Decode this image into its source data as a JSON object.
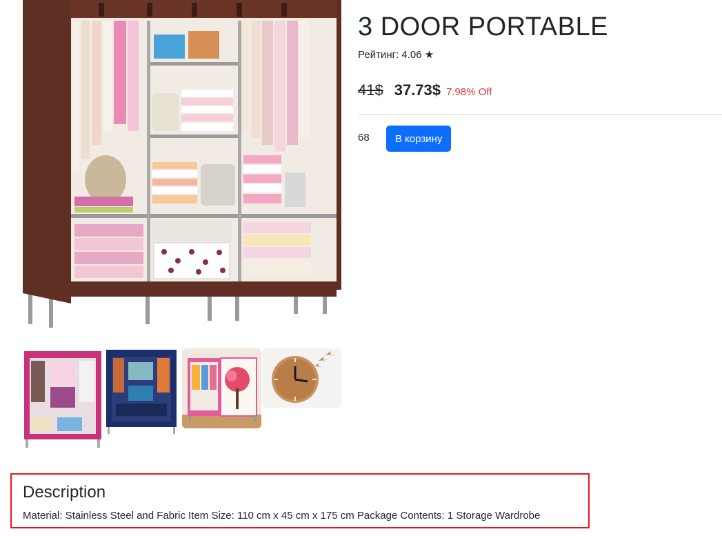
{
  "product": {
    "title": "3 DOOR PORTABLE",
    "rating_label": "Рейтинг: 4.06 ★",
    "old_price": "41$",
    "new_price": "37.73$",
    "discount": "7.98% Off",
    "stock_count": "68",
    "add_to_cart_label": "В корзину"
  },
  "gallery": {
    "main_image": "brown-wardrobe-photo",
    "thumbnails": [
      "pink-wardrobe-photo",
      "navy-wardrobe-photo",
      "cherry-tree-wardrobe-photo",
      "wooden-wall-clock-photo"
    ]
  },
  "description": {
    "heading": "Description",
    "text": "Material: Stainless Steel and Fabric Item Size: 110 cm x 45 cm x 175 cm Package Contents: 1 Storage Wardrobe"
  },
  "colors": {
    "button": "#0d6efd",
    "discount": "#dc3545",
    "highlight_border": "#e8131b",
    "wardrobe_brown": "#5e2f22"
  }
}
